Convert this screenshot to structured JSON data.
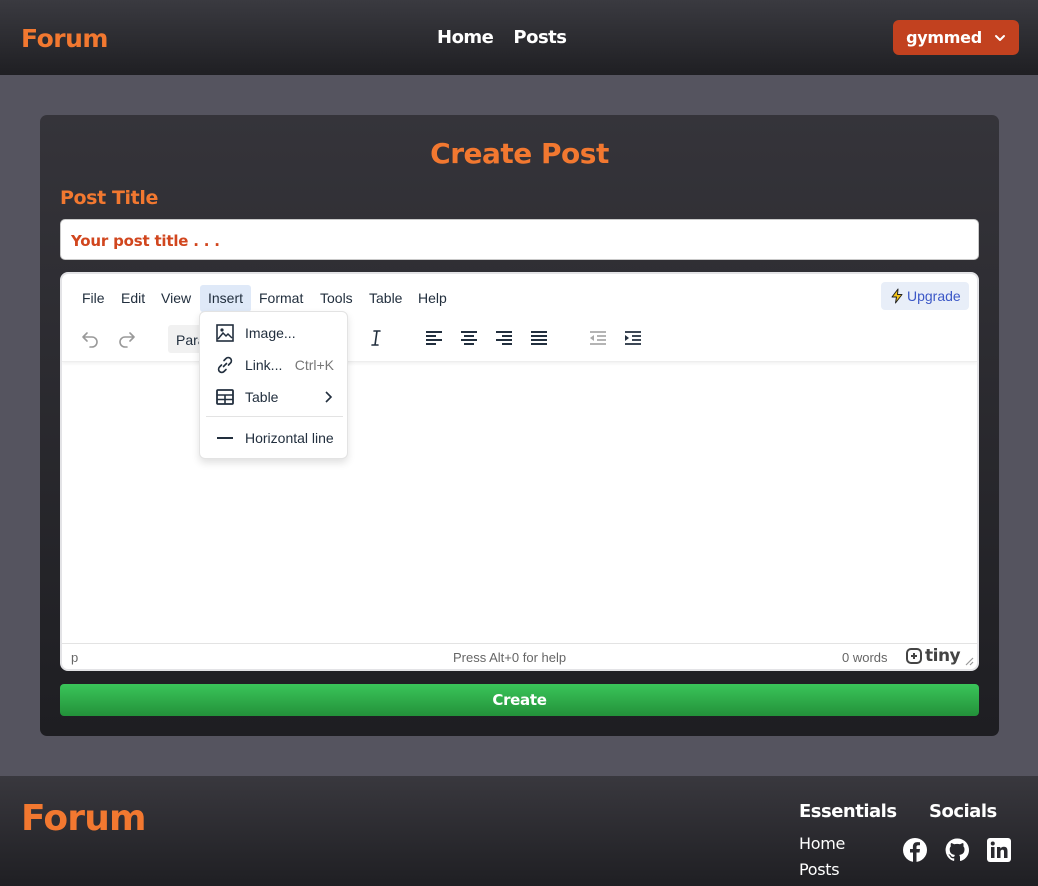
{
  "header": {
    "brand": "Forum",
    "nav": [
      {
        "label": "Home"
      },
      {
        "label": "Posts"
      }
    ],
    "user_button": "gymmed"
  },
  "form": {
    "heading": "Create Post",
    "title_label": "Post Title",
    "title_placeholder": "Your post title . . .",
    "submit_label": "Create"
  },
  "editor": {
    "menubar": [
      "File",
      "Edit",
      "View",
      "Insert",
      "Format",
      "Tools",
      "Table",
      "Help"
    ],
    "active_menu": "Insert",
    "upgrade_label": "Upgrade",
    "block_format": "Paragraph",
    "statusbar": {
      "path": "p",
      "help": "Press Alt+0 for help",
      "words": "0 words",
      "brand": "tiny"
    },
    "insert_menu": {
      "image": "Image...",
      "link": "Link...",
      "link_shortcut": "Ctrl+K",
      "table": "Table",
      "horizontal_line": "Horizontal line"
    }
  },
  "footer": {
    "brand": "Forum",
    "essentials_title": "Essentials",
    "essentials_links": [
      "Home",
      "Posts"
    ],
    "socials_title": "Socials",
    "socials": [
      "facebook-icon",
      "github-icon",
      "linkedin-icon"
    ]
  },
  "colors": {
    "accent": "#f27830",
    "user_button": "#c2411f",
    "create_button": "#2eab4a"
  }
}
